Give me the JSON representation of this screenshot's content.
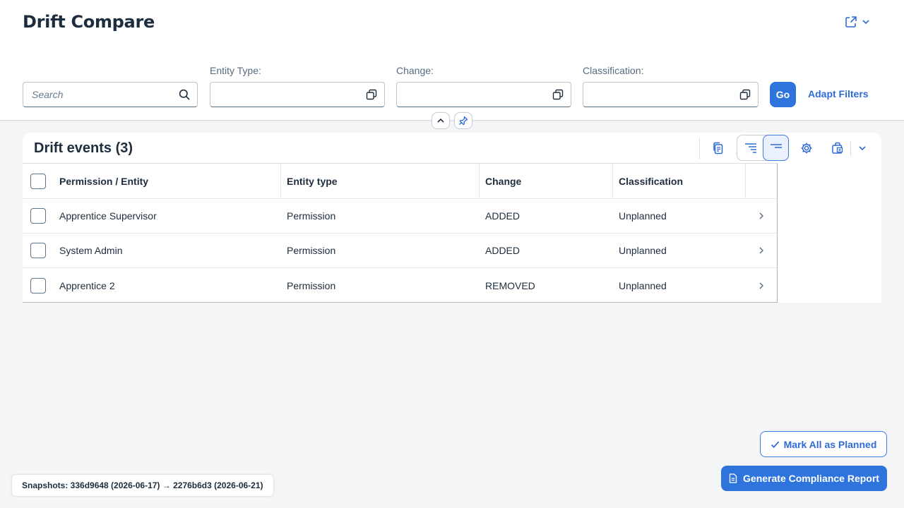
{
  "page": {
    "title": "Drift Compare"
  },
  "filters": {
    "search_placeholder": "Search",
    "entity_type_label": "Entity Type:",
    "change_label": "Change:",
    "classification_label": "Classification:",
    "go_label": "Go",
    "adapt_label": "Adapt Filters"
  },
  "table": {
    "title": "Drift events (3)",
    "columns": [
      "Permission / Entity",
      "Entity type",
      "Change",
      "Classification"
    ],
    "rows": [
      {
        "entity": "Apprentice Supervisor",
        "type": "Permission",
        "change": "ADDED",
        "classification": "Unplanned"
      },
      {
        "entity": "System Admin",
        "type": "Permission",
        "change": "ADDED",
        "classification": "Unplanned"
      },
      {
        "entity": "Apprentice 2",
        "type": "Permission",
        "change": "REMOVED",
        "classification": "Unplanned"
      }
    ]
  },
  "footer": {
    "mark_label": "Mark All as Planned",
    "generate_label": "Generate Compliance Report",
    "snapshots": "Snapshots: 336d9648 (2026-06-17) → 2276b6d3 (2026-06-21)"
  },
  "icons": {
    "share": "share-icon",
    "chevron": "chevron-down-icon",
    "search": "search-icon",
    "value_help": "value-help-icon",
    "collapse": "chevron-up-icon",
    "pin": "pin-icon",
    "copy": "copy-icon",
    "expand_all": "expand-all-icon",
    "collapse_all": "collapse-all-icon",
    "settings": "gear-icon",
    "export": "export-icon",
    "navigation": "chevron-right-icon",
    "check": "check-icon",
    "document": "document-icon"
  },
  "colors": {
    "accent": "#2f73dd",
    "link": "#2f6bd6",
    "background": "#f4f5f7",
    "text": "#1d2d3e"
  }
}
